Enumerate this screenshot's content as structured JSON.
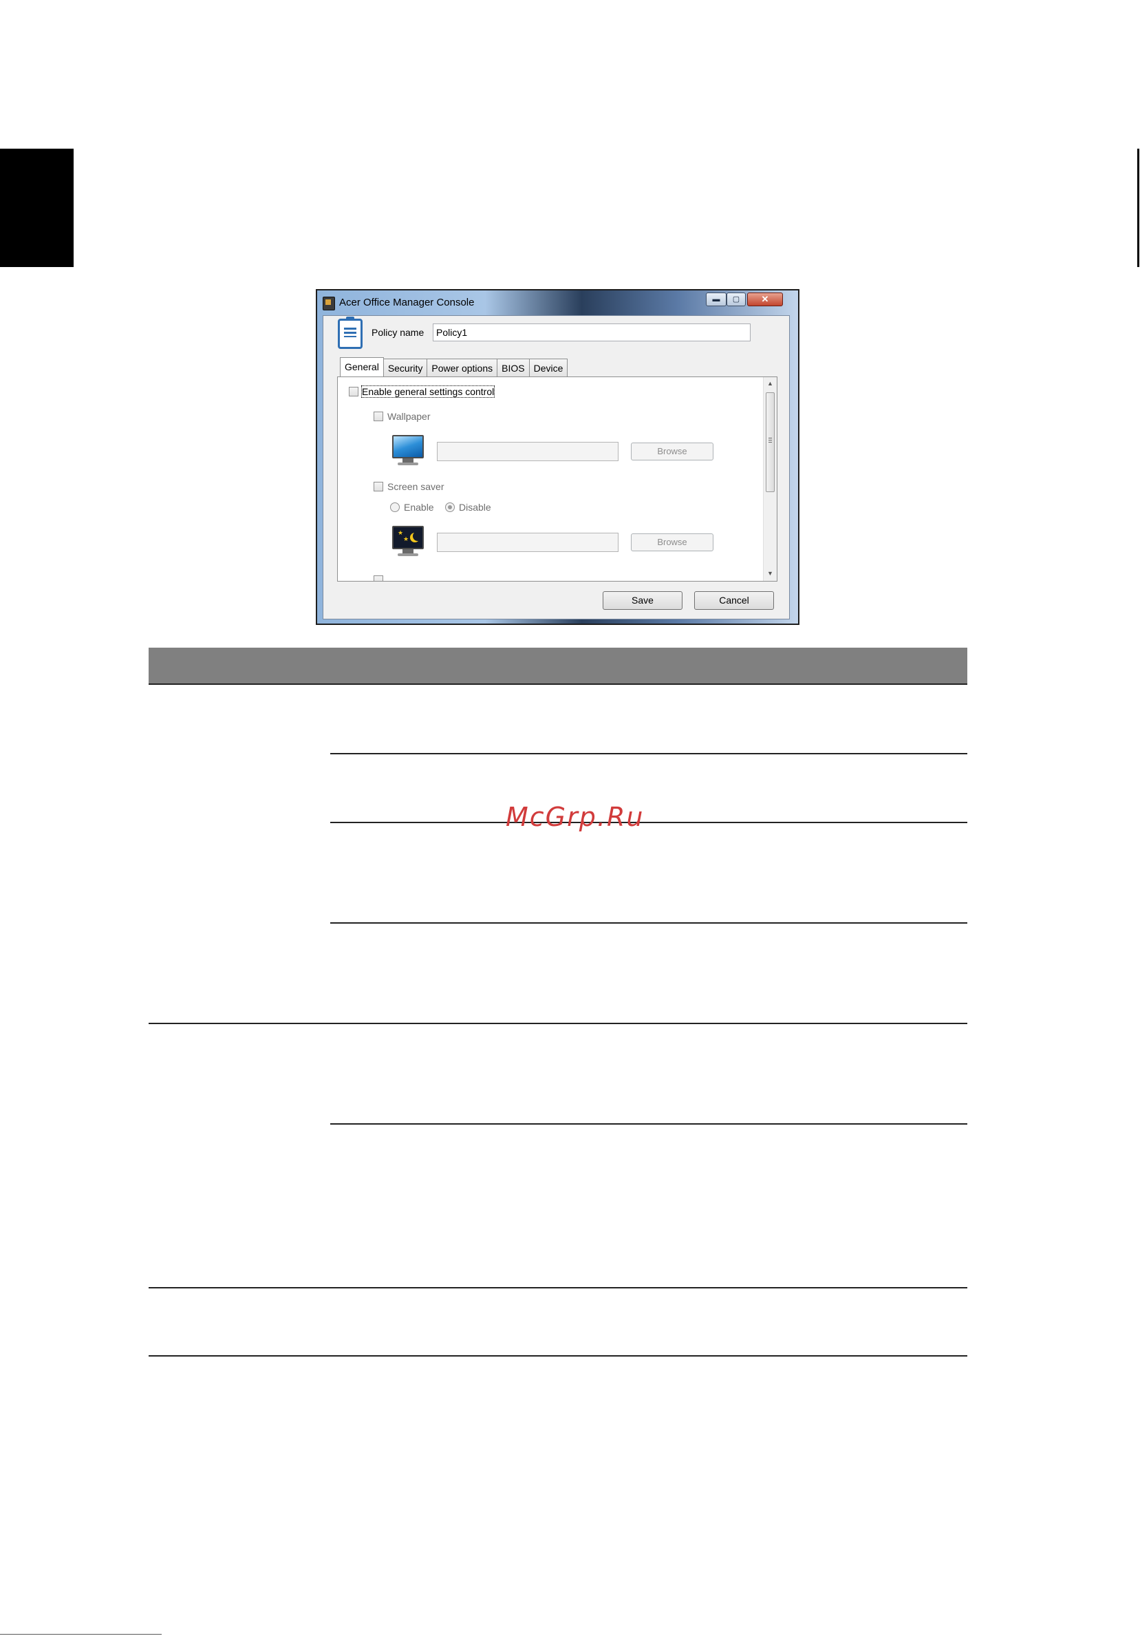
{
  "window": {
    "title": "Acer Office Manager Console",
    "controls": {
      "minimize": "▬",
      "maximize": "▢",
      "close": "✕"
    }
  },
  "policy": {
    "label": "Policy name",
    "value": "Policy1"
  },
  "tabs": [
    {
      "label": "General",
      "active": true
    },
    {
      "label": "Security",
      "active": false
    },
    {
      "label": "Power options",
      "active": false
    },
    {
      "label": "BIOS",
      "active": false
    },
    {
      "label": "Device",
      "active": false
    }
  ],
  "general": {
    "enable_control": {
      "label": "Enable general settings control",
      "checked": false
    },
    "wallpaper": {
      "label": "Wallpaper",
      "checked": false,
      "path": "",
      "browse": "Browse"
    },
    "screen_saver": {
      "label": "Screen saver",
      "checked": false,
      "options": [
        {
          "label": "Enable",
          "selected": false
        },
        {
          "label": "Disable",
          "selected": true
        }
      ],
      "path": "",
      "browse": "Browse"
    }
  },
  "buttons": {
    "save": "Save",
    "cancel": "Cancel"
  },
  "watermark": "McGrp.Ru",
  "icons": [
    "app-icon",
    "policy-clipboard-icon",
    "wallpaper-monitor-icon",
    "screensaver-monitor-icon",
    "scroll-up-arrow-icon",
    "scroll-down-arrow-icon"
  ]
}
